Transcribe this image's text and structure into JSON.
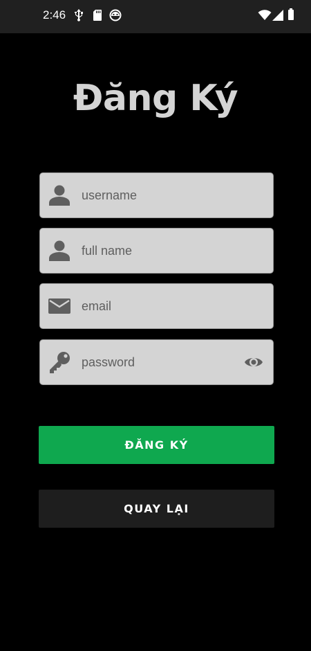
{
  "status_bar": {
    "time": "2:46",
    "icons": [
      "usb-icon",
      "sd-card-icon",
      "android-head-icon",
      "wifi-icon",
      "signal-icon",
      "battery-icon"
    ]
  },
  "title": "Đăng Ký",
  "form": {
    "username": {
      "placeholder": "username",
      "icon": "person-icon"
    },
    "fullname": {
      "placeholder": "full name",
      "icon": "person-icon"
    },
    "email": {
      "placeholder": "email",
      "icon": "email-icon"
    },
    "password": {
      "placeholder": "password",
      "icon": "key-icon",
      "toggle_icon": "eye-icon"
    }
  },
  "buttons": {
    "register": "ĐĂNG KÝ",
    "back": "QUAY LẠI"
  },
  "colors": {
    "background": "#000000",
    "status_bar": "#202020",
    "field_bg": "#d4d4d4",
    "icon": "#5f5f5f",
    "register_button": "#0fa84f",
    "back_button": "#1e1e1e",
    "title": "#d4d4d4"
  }
}
